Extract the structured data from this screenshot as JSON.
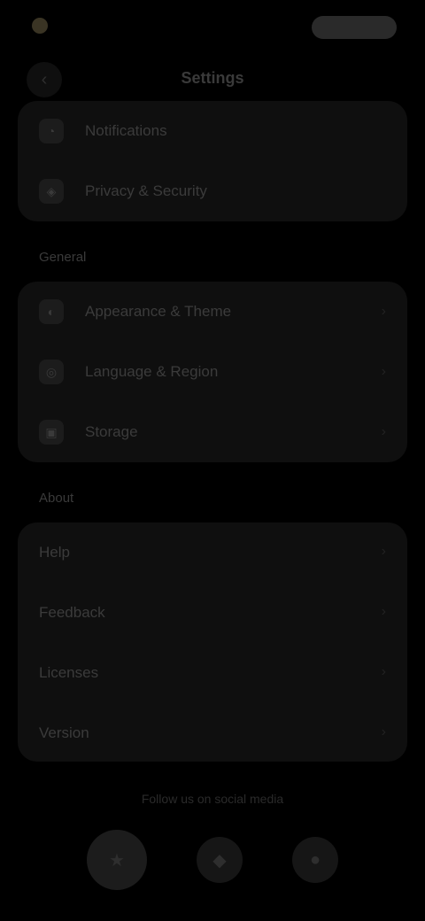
{
  "header": {
    "title": "Settings",
    "back_icon": "chevron-left-icon"
  },
  "card_top": [
    {
      "label": "Notifications",
      "icon": "bell-icon"
    },
    {
      "label": "Privacy & Security",
      "icon": "shield-icon"
    }
  ],
  "section_general": "General",
  "card_general": [
    {
      "label": "Appearance & Theme",
      "icon": "palette-icon"
    },
    {
      "label": "Language & Region",
      "icon": "globe-icon"
    },
    {
      "label": "Storage",
      "icon": "folder-icon"
    }
  ],
  "section_about": "About",
  "card_about": [
    {
      "label": "Help"
    },
    {
      "label": "Feedback"
    },
    {
      "label": "Licenses"
    },
    {
      "label": "Version"
    }
  ],
  "footer": {
    "text": "Follow us on social media"
  }
}
